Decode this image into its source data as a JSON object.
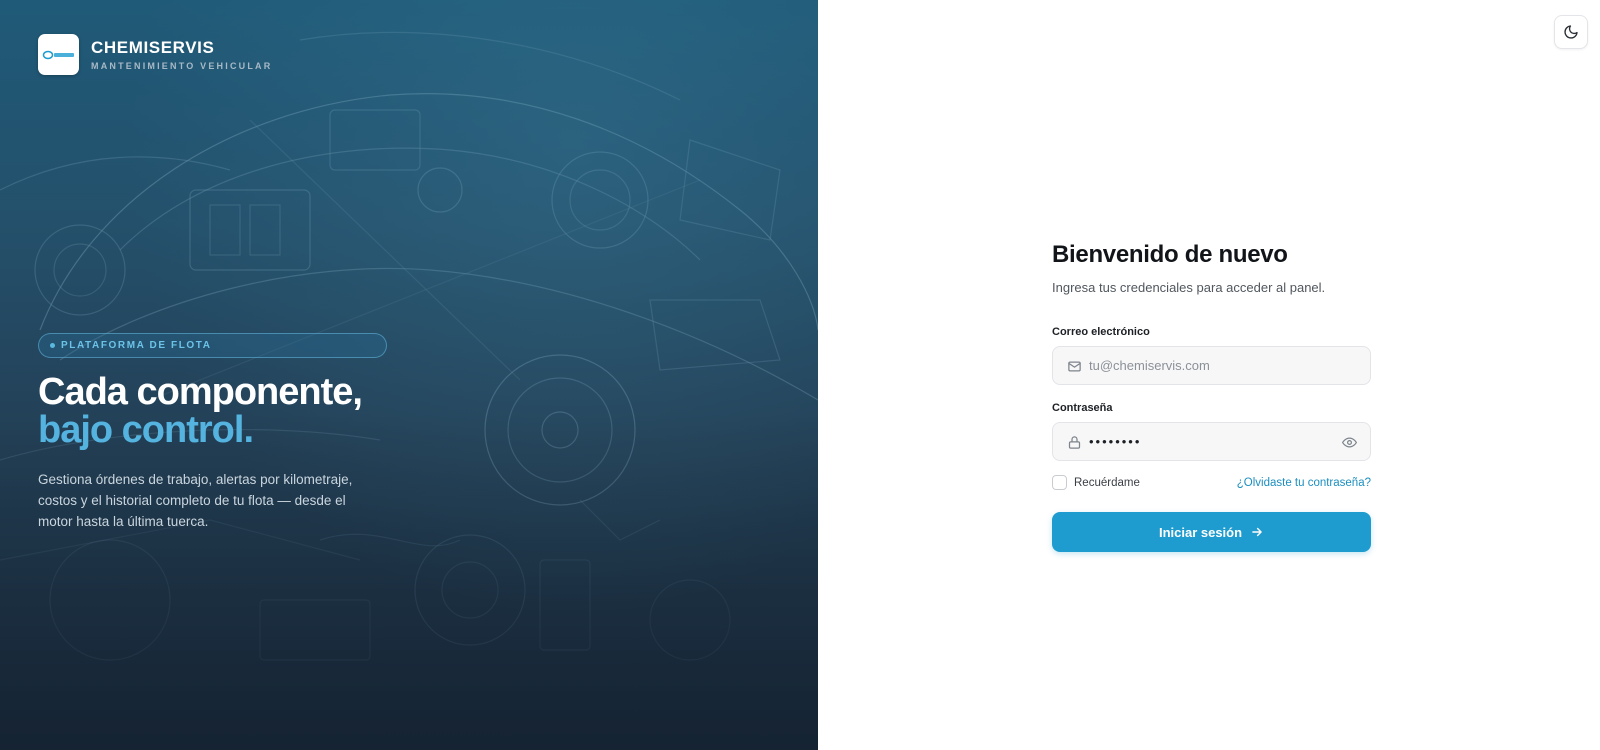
{
  "brand": {
    "name": "CHEMISERVIS",
    "tagline": "MANTENIMIENTO VEHICULAR",
    "logo_icon": "chemiservis-logo"
  },
  "hero": {
    "badge": "PLATAFORMA DE FLOTA",
    "headline_line1": "Cada componente,",
    "headline_line2": "bajo control.",
    "description": "Gestiona órdenes de trabajo, alertas por kilometraje, costos y el historial completo de tu flota — desde el motor hasta la última tuerca.",
    "background_art": "vehicle-blueprint-sketch"
  },
  "colors": {
    "accent": "#1e9ccf",
    "headline_accent": "#55b3e0",
    "hero_bg": "#24506b"
  },
  "theme_toggle": {
    "icon": "moon-icon"
  },
  "login": {
    "title": "Bienvenido de nuevo",
    "subtitle": "Ingresa tus credenciales para acceder al panel.",
    "email_label": "Correo electrónico",
    "email_placeholder": "tu@chemiservis.com",
    "email_value": "",
    "password_label": "Contraseña",
    "password_value": "••••••••",
    "remember_label": "Recuérdame",
    "remember_checked": false,
    "forgot_label": "¿Olvidaste tu contraseña?",
    "submit_label": "Iniciar sesión"
  }
}
